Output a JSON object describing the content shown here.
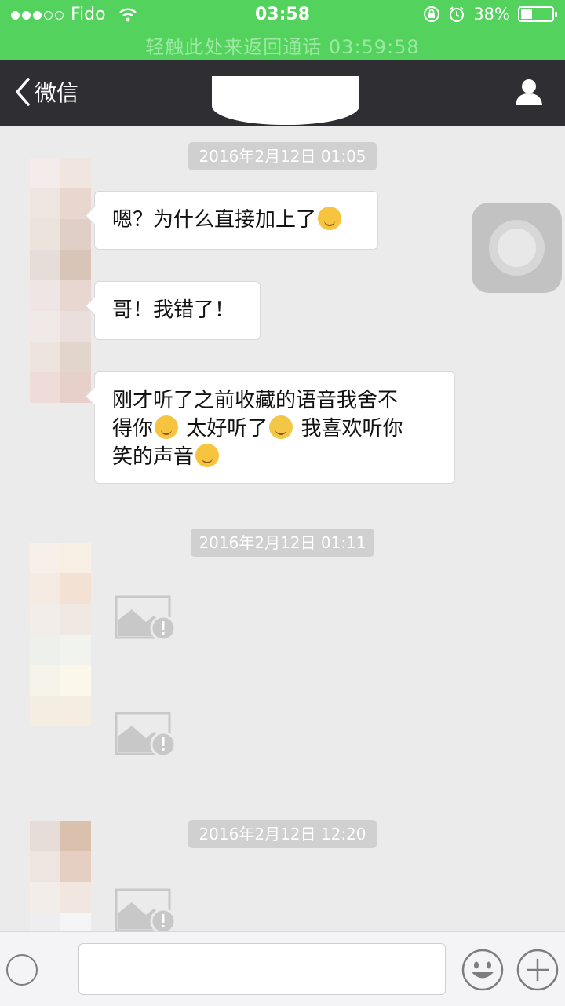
{
  "status_bar": {
    "carrier": "Fido",
    "time": "03:58",
    "battery": "38%",
    "battery_level": 0.38,
    "icons": [
      "wifi-icon",
      "orientation-lock-icon",
      "alarm-icon",
      "battery-icon"
    ]
  },
  "call_banner": {
    "text": "轻触此处来返回通话  03:59:58"
  },
  "nav": {
    "back_label": "微信",
    "profile_icon": "person-icon"
  },
  "messages": [
    {
      "type": "timestamp",
      "text": "2016年2月12日 01:05"
    },
    {
      "type": "text",
      "text": "嗯？为什么直接加上了",
      "emoji": "dizzy-face-emoji"
    },
    {
      "type": "text",
      "text": "哥！我错了！"
    },
    {
      "type": "text",
      "line1": "刚才听了之前收藏的语音我舍不",
      "line2a": "得你",
      "line2b": " 太好听了",
      "line2c": " 我喜欢听你",
      "line3": "笑的声音",
      "emojis": [
        "persevering-face-emoji",
        "crying-face-emoji",
        "hugging-face-emoji"
      ]
    },
    {
      "type": "timestamp",
      "text": "2016年2月12日 01:11"
    },
    {
      "type": "image",
      "status": "failed"
    },
    {
      "type": "image",
      "status": "failed"
    },
    {
      "type": "timestamp",
      "text": "2016年2月12日 12:20"
    },
    {
      "type": "image",
      "status": "failed"
    }
  ],
  "colors": {
    "status_green": "#53d25d",
    "nav_dark": "#2f2f33",
    "chat_bg": "#ebebeb"
  }
}
